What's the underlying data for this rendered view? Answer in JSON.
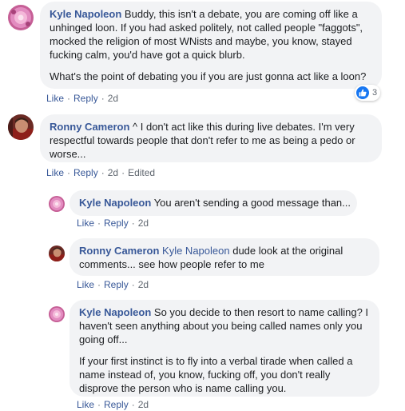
{
  "thread": [
    {
      "author": "Kyle Napoleon",
      "paragraphs": [
        "Buddy, this isn't a debate, you are coming off like a unhinged loon. If you had asked politely, not called people \"faggots\", mocked the religion of most WNists and maybe, you know, stayed fucking calm, you'd have got a quick blurb.",
        "What's the point of debating you if you are just gonna act like a loon?"
      ],
      "reaction_count": "3",
      "actions": {
        "like": "Like",
        "reply": "Reply",
        "time": "2d"
      }
    },
    {
      "author": "Ronny Cameron",
      "text": "^ I don't act like this during live debates. I'm very respectful towards people that don't refer to me as being a pedo or worse...",
      "actions": {
        "like": "Like",
        "reply": "Reply",
        "time": "2d",
        "edited": "Edited"
      }
    }
  ],
  "replies": [
    {
      "author": "Kyle Napoleon",
      "text": "You aren't sending a good message than...",
      "actions": {
        "like": "Like",
        "reply": "Reply",
        "time": "2d"
      }
    },
    {
      "author": "Ronny Cameron",
      "mention": "Kyle Napoleon",
      "text": "dude look at the original comments... see how people refer to me",
      "actions": {
        "like": "Like",
        "reply": "Reply",
        "time": "2d"
      }
    },
    {
      "author": "Kyle Napoleon",
      "paragraphs": [
        "So you decide to then resort to name calling? I haven't seen anything about you being called names only you going off...",
        "If your first instinct is to fly into a verbal tirade when called a name instead of, you know, fucking off, you don't really disprove the person who is name calling you."
      ],
      "actions": {
        "like": "Like",
        "reply": "Reply",
        "time": "2d"
      }
    }
  ],
  "colors": {
    "name": "#385898",
    "bubble": "#f2f3f5",
    "meta": "#606770",
    "like_badge": "#1877f2"
  }
}
